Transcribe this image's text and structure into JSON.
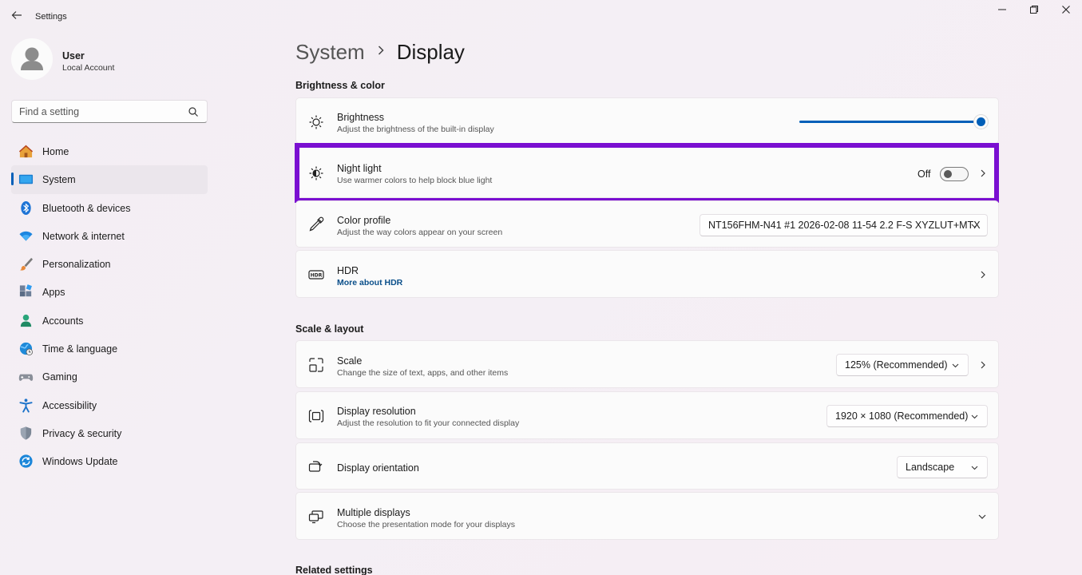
{
  "window": {
    "title": "Settings"
  },
  "user": {
    "name": "User",
    "account_type": "Local Account"
  },
  "search": {
    "placeholder": "Find a setting"
  },
  "sidebar": {
    "items": [
      {
        "label": "Home",
        "icon": "home-icon"
      },
      {
        "label": "System",
        "icon": "system-icon",
        "active": true
      },
      {
        "label": "Bluetooth & devices",
        "icon": "bluetooth-icon"
      },
      {
        "label": "Network & internet",
        "icon": "wifi-icon"
      },
      {
        "label": "Personalization",
        "icon": "brush-icon"
      },
      {
        "label": "Apps",
        "icon": "apps-icon"
      },
      {
        "label": "Accounts",
        "icon": "accounts-icon"
      },
      {
        "label": "Time & language",
        "icon": "globe-clock-icon"
      },
      {
        "label": "Gaming",
        "icon": "gamepad-icon"
      },
      {
        "label": "Accessibility",
        "icon": "accessibility-icon"
      },
      {
        "label": "Privacy & security",
        "icon": "shield-icon"
      },
      {
        "label": "Windows Update",
        "icon": "update-icon"
      }
    ]
  },
  "breadcrumb": {
    "parent": "System",
    "current": "Display"
  },
  "sections": {
    "brightness_color": "Brightness & color",
    "scale_layout": "Scale & layout",
    "related": "Related settings"
  },
  "brightness": {
    "title": "Brightness",
    "subtitle": "Adjust the brightness of the built-in display",
    "value_percent": 100
  },
  "night_light": {
    "title": "Night light",
    "subtitle": "Use warmer colors to help block blue light",
    "state_label": "Off",
    "on": false
  },
  "color_profile": {
    "title": "Color profile",
    "subtitle": "Adjust the way colors appear on your screen",
    "value": "NT156FHM-N41 #1 2026-02-08 11-54 2.2 F-S XYZLUT+MTX"
  },
  "hdr": {
    "title": "HDR",
    "link": "More about HDR"
  },
  "scale": {
    "title": "Scale",
    "subtitle": "Change the size of text, apps, and other items",
    "value": "125% (Recommended)"
  },
  "resolution": {
    "title": "Display resolution",
    "subtitle": "Adjust the resolution to fit your connected display",
    "value": "1920 × 1080 (Recommended)"
  },
  "orientation": {
    "title": "Display orientation",
    "value": "Landscape"
  },
  "multiple_displays": {
    "title": "Multiple displays",
    "subtitle": "Choose the presentation mode for your displays"
  },
  "colors": {
    "accent": "#005fb8",
    "highlight": "#7a0fd1"
  }
}
